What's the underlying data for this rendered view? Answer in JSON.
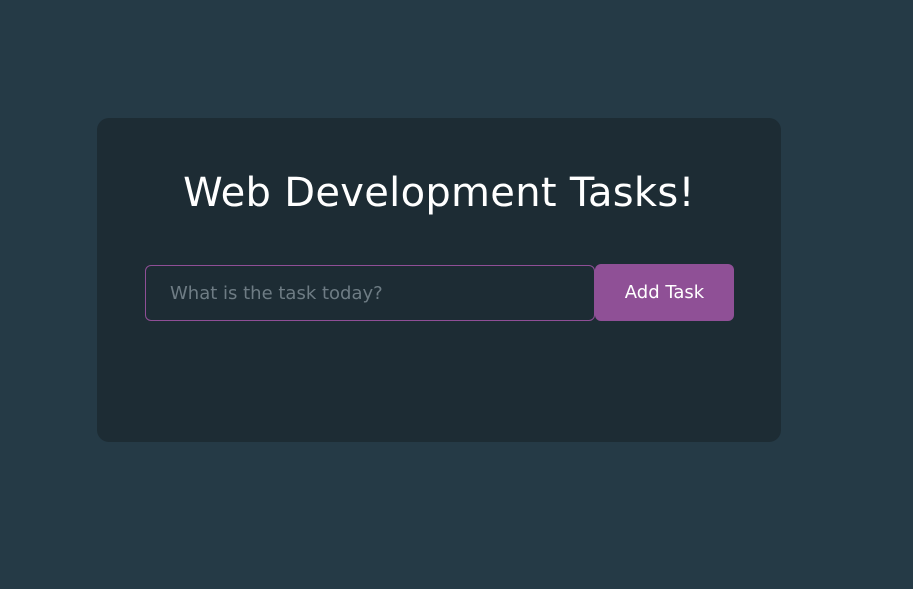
{
  "app": {
    "title": "Web Development Tasks!"
  },
  "task_form": {
    "input_value": "",
    "input_placeholder": "What is the task today?",
    "add_button_label": "Add Task"
  },
  "colors": {
    "page_background": "#253a46",
    "card_background": "#1d2c34",
    "accent": "#8f5096",
    "placeholder_text": "#6e7c84"
  }
}
